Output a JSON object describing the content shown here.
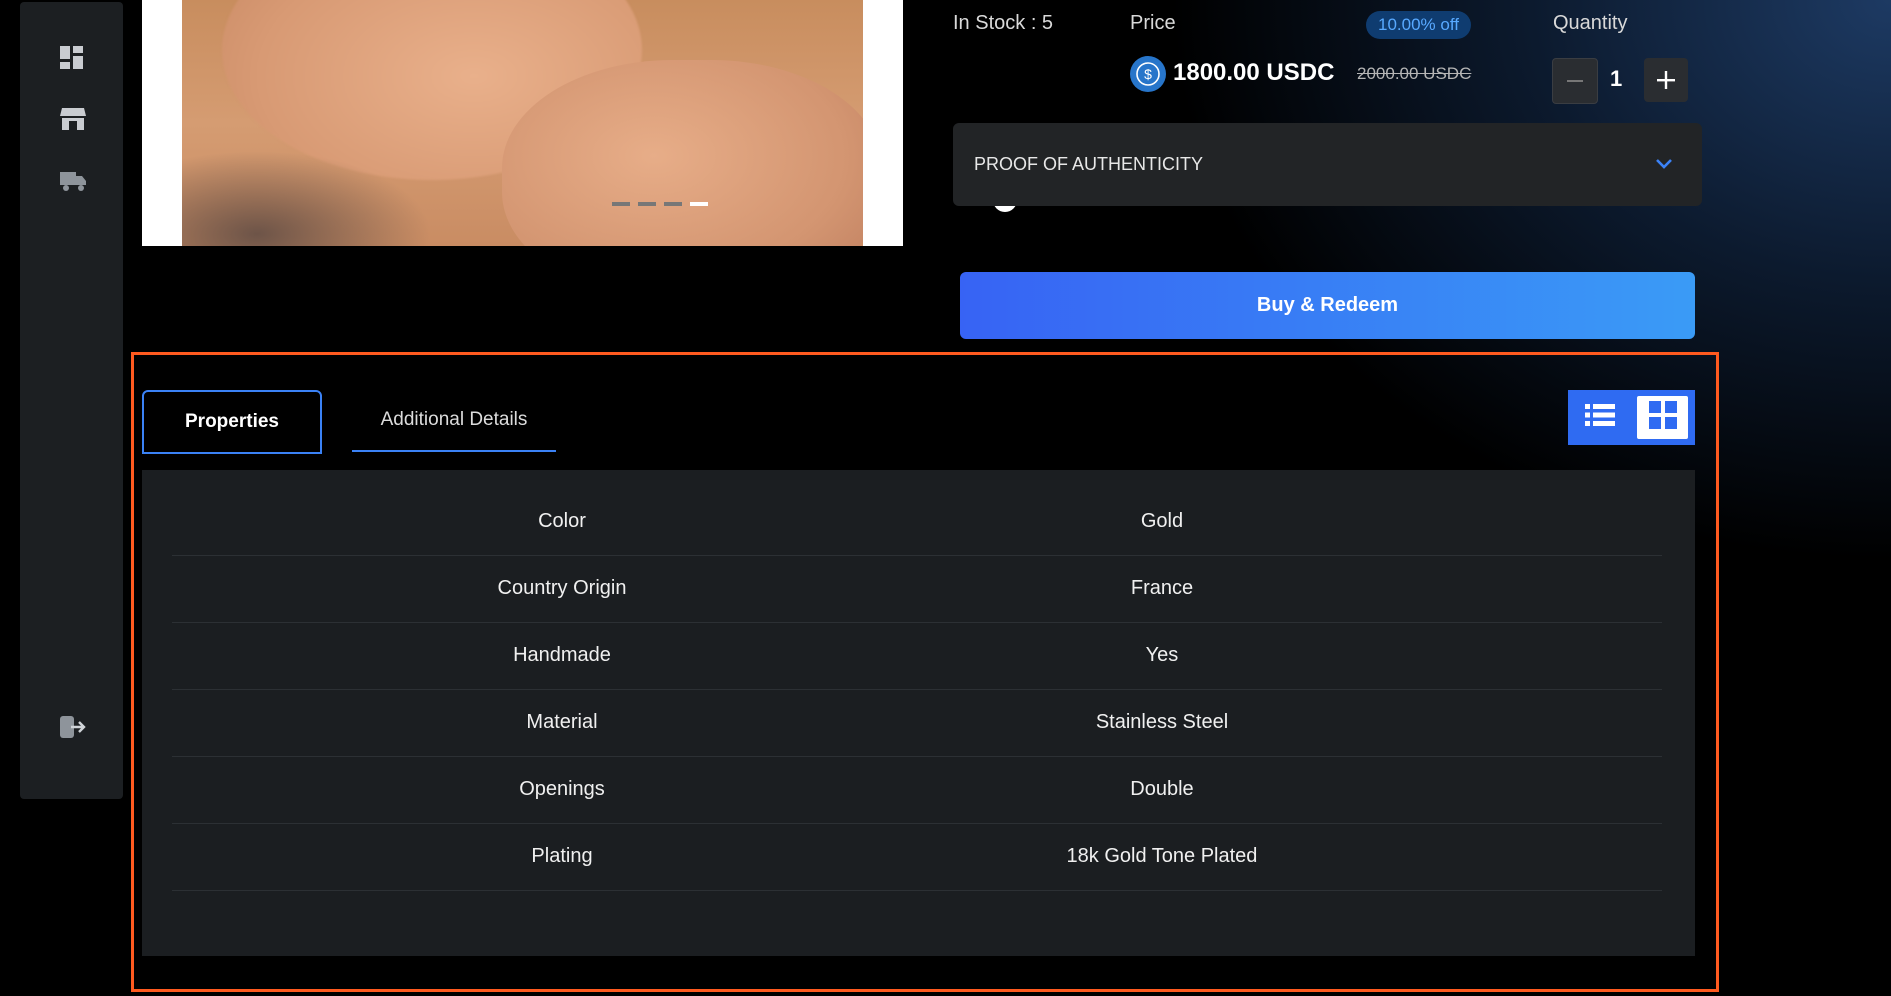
{
  "sidebar": {
    "items": [
      {
        "icon": "dashboard-icon"
      },
      {
        "icon": "store-icon"
      },
      {
        "icon": "delivery-truck-icon"
      }
    ],
    "logout_icon": "logout-icon"
  },
  "product": {
    "stock_text": "In Stock : 5",
    "price_label": "Price",
    "discount": "10.00% off",
    "price": "1800.00 USDC",
    "old_price": "2000.00 USDC",
    "quantity_label": "Quantity",
    "quantity": "1",
    "currency_icon": "usdc-icon",
    "accordion_label": "PROOF OF AUTHENTICITY",
    "buy_label": "Buy & Redeem",
    "carousel": {
      "count": 4,
      "active_index": 3
    }
  },
  "details": {
    "tabs": [
      {
        "label": "Properties",
        "active": true
      },
      {
        "label": "Additional Details",
        "active": false
      }
    ],
    "view_modes": [
      {
        "icon": "list-view-icon",
        "active": false
      },
      {
        "icon": "grid-view-icon",
        "active": true
      }
    ],
    "rows": [
      {
        "key": "Color",
        "value": "Gold"
      },
      {
        "key": "Country Origin",
        "value": "France"
      },
      {
        "key": "Handmade",
        "value": "Yes"
      },
      {
        "key": "Material",
        "value": "Stainless Steel"
      },
      {
        "key": "Openings",
        "value": "Double"
      },
      {
        "key": "Plating",
        "value": "18k Gold Tone Plated"
      }
    ]
  },
  "colors": {
    "accent": "#3b82f6",
    "highlight": "#ff5a1f",
    "buy_gradient_start": "#3763f4",
    "buy_gradient_end": "#3a9bf6"
  }
}
